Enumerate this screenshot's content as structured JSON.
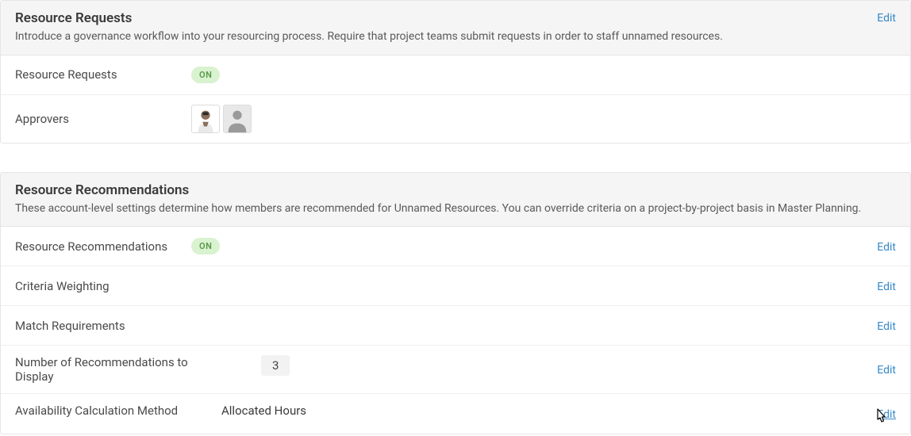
{
  "sections": {
    "resource_requests": {
      "title": "Resource Requests",
      "description": "Introduce a governance workflow into your resourcing process. Require that project teams submit requests in order to staff unnamed resources.",
      "edit_label": "Edit",
      "rows": {
        "status": {
          "label": "Resource Requests",
          "value": "ON"
        },
        "approvers": {
          "label": "Approvers"
        }
      }
    },
    "resource_recommendations": {
      "title": "Resource Recommendations",
      "description": "These account-level settings determine how members are recommended for Unnamed Resources. You can override criteria on a project-by-project basis in Master Planning.",
      "rows": {
        "status": {
          "label": "Resource Recommendations",
          "value": "ON",
          "edit_label": "Edit"
        },
        "criteria_weighting": {
          "label": "Criteria Weighting",
          "edit_label": "Edit"
        },
        "match_requirements": {
          "label": "Match Requirements",
          "edit_label": "Edit"
        },
        "num_recommendations": {
          "label": "Number of Recommendations to Display",
          "value": "3",
          "edit_label": "Edit"
        },
        "availability_method": {
          "label": "Availability Calculation Method",
          "value": "Allocated Hours",
          "edit_label": "Edit"
        }
      }
    }
  }
}
